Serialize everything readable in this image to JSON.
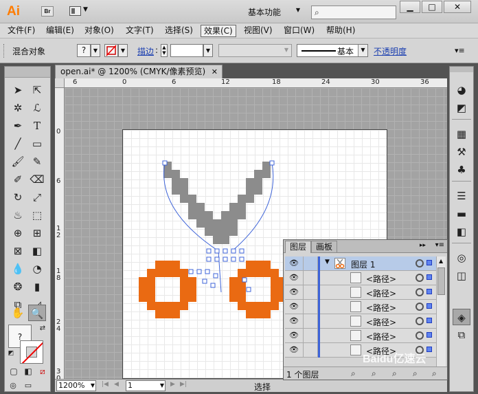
{
  "app": {
    "logo": "Ai",
    "bridge": "Br",
    "workspace": "基本功能"
  },
  "window_controls": {
    "minimize": "▁",
    "maximize": "□",
    "close": "✕"
  },
  "menu": [
    "文件(F)",
    "编辑(E)",
    "对象(O)",
    "文字(T)",
    "选择(S)",
    "效果(C)",
    "视图(V)",
    "窗口(W)",
    "帮助(H)"
  ],
  "active_menu": "效果(C)",
  "control_bar": {
    "label": "混合对象",
    "fill_swatch": "?",
    "stroke_link": "描边",
    "stroke_style": "基本",
    "opacity_link": "不透明度"
  },
  "document": {
    "tab_title": "open.ai* @ 1200% (CMYK/像素预览)",
    "close": "✕",
    "ruler_top": [
      "6",
      "0",
      "6",
      "12",
      "18",
      "24",
      "30",
      "36"
    ],
    "ruler_left": [
      "0",
      "6",
      "12",
      "18",
      "24",
      "30"
    ]
  },
  "status_bar": {
    "zoom": "1200%",
    "page": "1",
    "status": "选择"
  },
  "tools": {
    "fill_question": "?"
  },
  "layers_panel": {
    "tabs": [
      "图层",
      "画板"
    ],
    "rows": [
      {
        "label": "图层 1",
        "type": "layer"
      },
      {
        "label": "<路径>",
        "type": "path"
      },
      {
        "label": "<路径>",
        "type": "path"
      },
      {
        "label": "<路径>",
        "type": "path"
      },
      {
        "label": "<路径>",
        "type": "path"
      },
      {
        "label": "<路径>",
        "type": "path"
      },
      {
        "label": "<路径>",
        "type": "path"
      }
    ],
    "count": "1 个图层"
  },
  "colors": {
    "accent_orange": "#ff7c00",
    "selection_blue": "#3d63d8",
    "scissor_orange": "#ea6a12",
    "scissor_gray": "#8c8c8c"
  },
  "watermark": "Baidu亿速云"
}
